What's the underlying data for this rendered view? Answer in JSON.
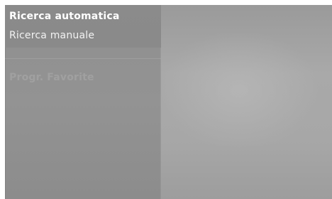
{
  "menu": {
    "items": [
      {
        "label": "Ricerca automatica"
      },
      {
        "label": "Ricerca manuale"
      },
      {
        "label": "Progr. Favorite"
      }
    ]
  }
}
